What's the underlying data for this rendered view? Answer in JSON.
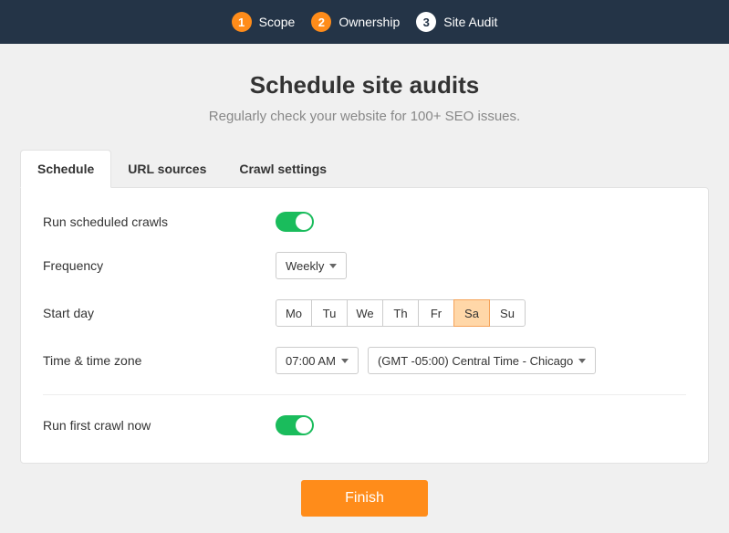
{
  "stepper": {
    "steps": [
      {
        "num": "1",
        "label": "Scope",
        "active": false
      },
      {
        "num": "2",
        "label": "Ownership",
        "active": false
      },
      {
        "num": "3",
        "label": "Site Audit",
        "active": true
      }
    ]
  },
  "header": {
    "title": "Schedule site audits",
    "subtitle": "Regularly check your website for 100+ SEO issues."
  },
  "tabs": [
    {
      "label": "Schedule",
      "active": true
    },
    {
      "label": "URL sources",
      "active": false
    },
    {
      "label": "Crawl settings",
      "active": false
    }
  ],
  "form": {
    "run_scheduled_label": "Run scheduled crawls",
    "run_scheduled_on": true,
    "frequency_label": "Frequency",
    "frequency_value": "Weekly",
    "start_day_label": "Start day",
    "days": [
      {
        "abbr": "Mo",
        "selected": false
      },
      {
        "abbr": "Tu",
        "selected": false
      },
      {
        "abbr": "We",
        "selected": false
      },
      {
        "abbr": "Th",
        "selected": false
      },
      {
        "abbr": "Fr",
        "selected": false
      },
      {
        "abbr": "Sa",
        "selected": true
      },
      {
        "abbr": "Su",
        "selected": false
      }
    ],
    "time_label": "Time & time zone",
    "time_value": "07:00 AM",
    "tz_value": "(GMT -05:00) Central Time - Chicago",
    "run_first_label": "Run first crawl now",
    "run_first_on": true
  },
  "finish_label": "Finish"
}
